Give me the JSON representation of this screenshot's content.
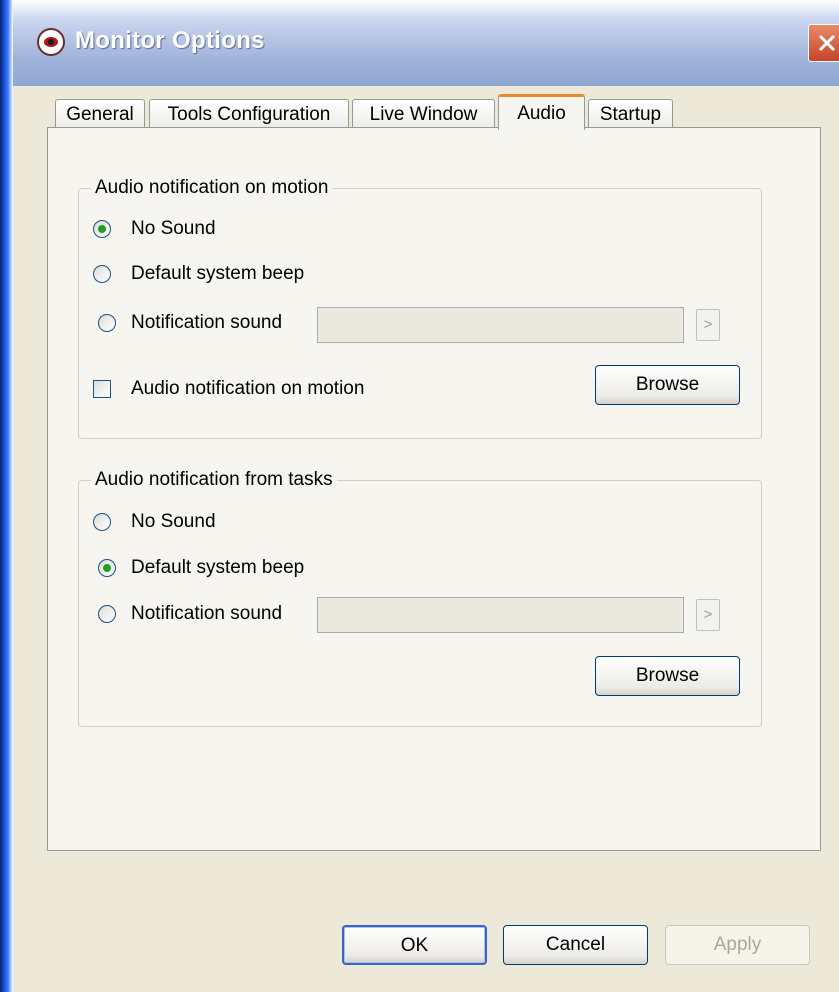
{
  "window": {
    "title": "Monitor Options",
    "close_icon": "close-icon"
  },
  "tabs": [
    {
      "label": "General",
      "active": false
    },
    {
      "label": "Tools Configuration",
      "active": false
    },
    {
      "label": "Live Window",
      "active": false
    },
    {
      "label": "Audio",
      "active": true
    },
    {
      "label": "Startup",
      "active": false
    }
  ],
  "motion_group": {
    "legend": "Audio notification on motion",
    "options": [
      {
        "label": "No Sound",
        "checked": true
      },
      {
        "label": "Default system beep",
        "checked": false
      },
      {
        "label": "Notification sound",
        "checked": false
      }
    ],
    "sound_path": "",
    "arrow_label": ">",
    "checkbox_label": "Audio notification on motion",
    "checkbox_checked": false,
    "browse_label": "Browse"
  },
  "tasks_group": {
    "legend": "Audio notification from tasks",
    "options": [
      {
        "label": "No Sound",
        "checked": false
      },
      {
        "label": "Default system beep",
        "checked": true
      },
      {
        "label": "Notification sound",
        "checked": false
      }
    ],
    "sound_path": "",
    "arrow_label": ">",
    "browse_label": "Browse"
  },
  "footer": {
    "ok_label": "OK",
    "cancel_label": "Cancel",
    "apply_label": "Apply"
  },
  "colors": {
    "accent_tab": "#e68b2c",
    "radio_checked": "#21a121",
    "title_text": "#ffffff"
  }
}
